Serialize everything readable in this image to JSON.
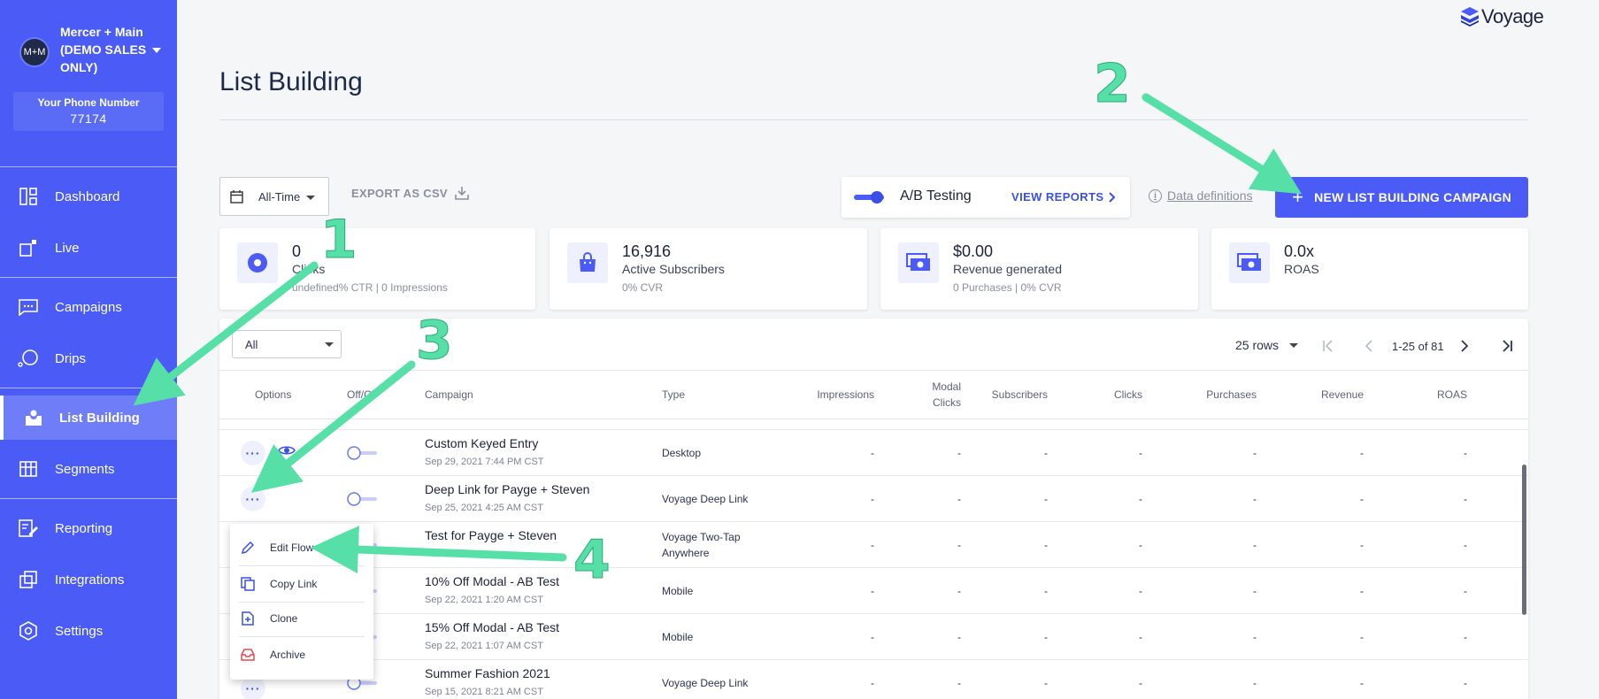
{
  "sidebar": {
    "account_initials": "M+M",
    "account_name": "Mercer + Main (DEMO SALES ONLY)",
    "phone_label": "Your Phone Number",
    "phone_number": "77174",
    "items": [
      {
        "label": "Dashboard",
        "icon": "dashboard-icon"
      },
      {
        "label": "Live",
        "icon": "live-icon"
      },
      {
        "label": "Campaigns",
        "icon": "campaigns-icon"
      },
      {
        "label": "Drips",
        "icon": "drips-icon"
      },
      {
        "label": "List Building",
        "icon": "list-building-icon",
        "active": true
      },
      {
        "label": "Segments",
        "icon": "segments-icon"
      },
      {
        "label": "Reporting",
        "icon": "reporting-icon"
      },
      {
        "label": "Integrations",
        "icon": "integrations-icon"
      },
      {
        "label": "Settings",
        "icon": "settings-icon"
      }
    ]
  },
  "brand": {
    "logo_text": "Voyage"
  },
  "page": {
    "title": "List Building"
  },
  "toolbar": {
    "date_range": "All-Time",
    "export_label": "EXPORT AS CSV",
    "ab_label": "A/B Testing",
    "view_reports_label": "VIEW REPORTS",
    "data_definitions_label": "Data definitions",
    "new_campaign_label": "NEW LIST BUILDING CAMPAIGN"
  },
  "stats": [
    {
      "value": "0",
      "label": "Clicks",
      "sub": "undefined% CTR | 0 Impressions",
      "icon": "target-icon"
    },
    {
      "value": "16,916",
      "label": "Active Subscribers",
      "sub": "0% CVR",
      "icon": "shopping-bag-icon"
    },
    {
      "value": "$0.00",
      "label": "Revenue generated",
      "sub": "0 Purchases | 0% CVR",
      "icon": "money-icon"
    },
    {
      "value": "0.0x",
      "label": "ROAS",
      "sub": "",
      "icon": "money-icon"
    }
  ],
  "table": {
    "filter_value": "All",
    "rows_per_page": "25 rows",
    "page_range": "1-25 of 81",
    "columns": {
      "options": "Options",
      "onoff": "Off/O",
      "campaign": "Campaign",
      "type": "Type",
      "impressions": "Impressions",
      "modal_clicks_1": "Modal",
      "modal_clicks_2": "Clicks",
      "subscribers": "Subscribers",
      "clicks": "Clicks",
      "purchases": "Purchases",
      "revenue": "Revenue",
      "roas": "ROAS"
    },
    "rows": [
      {
        "name": "Custom Keyed Entry",
        "date": "Sep 29, 2021 7:44 PM CST",
        "type": "Desktop",
        "type2": "",
        "impressions": "-",
        "modal_clicks": "-",
        "subscribers": "-",
        "clicks": "-",
        "purchases": "-",
        "revenue": "-",
        "roas": "-"
      },
      {
        "name": "Deep Link for Payge + Steven",
        "date": "Sep 25, 2021 4:25 AM CST",
        "type": "Voyage Deep Link",
        "type2": "",
        "impressions": "-",
        "modal_clicks": "-",
        "subscribers": "-",
        "clicks": "-",
        "purchases": "-",
        "revenue": "-",
        "roas": "-"
      },
      {
        "name": "Test for Payge + Steven",
        "date": "",
        "type": "Voyage Two-Tap",
        "type2": "Anywhere",
        "impressions": "-",
        "modal_clicks": "-",
        "subscribers": "-",
        "clicks": "-",
        "purchases": "-",
        "revenue": "-",
        "roas": "-"
      },
      {
        "name": "10% Off Modal - AB Test",
        "date": "Sep 22, 2021 1:20 AM CST",
        "type": "Mobile",
        "type2": "",
        "impressions": "-",
        "modal_clicks": "-",
        "subscribers": "-",
        "clicks": "-",
        "purchases": "-",
        "revenue": "-",
        "roas": "-"
      },
      {
        "name": "15% Off Modal - AB Test",
        "date": "Sep 22, 2021 1:07 AM CST",
        "type": "Mobile",
        "type2": "",
        "impressions": "-",
        "modal_clicks": "-",
        "subscribers": "-",
        "clicks": "-",
        "purchases": "-",
        "revenue": "-",
        "roas": "-"
      },
      {
        "name": "Summer Fashion 2021",
        "date": "Sep 15, 2021 8:21 AM CST",
        "type": "Voyage Deep Link",
        "type2": "",
        "impressions": "-",
        "modal_clicks": "-",
        "subscribers": "-",
        "clicks": "-",
        "purchases": "-",
        "revenue": "-",
        "roas": "-"
      }
    ]
  },
  "menu": {
    "items": [
      {
        "label": "Edit Flow",
        "icon": "pencil-icon"
      },
      {
        "label": "Copy Link",
        "icon": "copy-icon"
      },
      {
        "label": "Clone",
        "icon": "clone-icon"
      },
      {
        "label": "Archive",
        "icon": "archive-icon"
      }
    ]
  },
  "annotations": {
    "n1": "1",
    "n2": "2",
    "n3": "3",
    "n4": "4"
  },
  "colors": {
    "accent": "#4a5cf5",
    "annotation": "#56e0a8",
    "archive": "#e5484d"
  }
}
